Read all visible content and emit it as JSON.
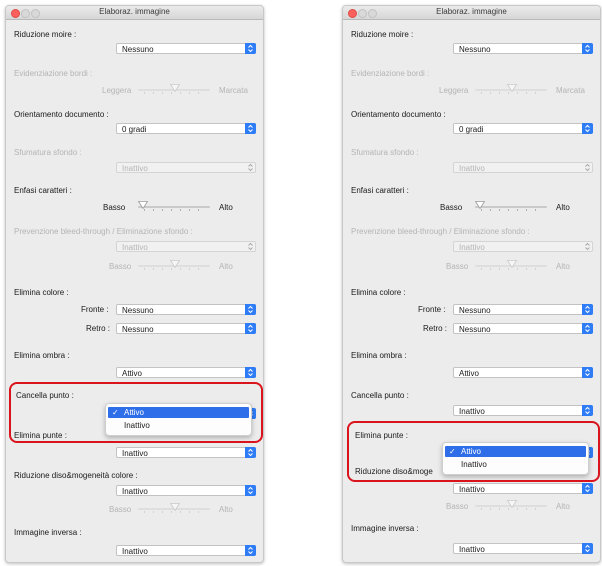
{
  "window_title": "Elaboraz. immagine",
  "moire": {
    "label": "Riduzione moire :",
    "value": "Nessuno"
  },
  "edge": {
    "label": "Evidenziazione bordi :",
    "low": "Leggera",
    "high": "Marcata"
  },
  "orient": {
    "label": "Orientamento documento :",
    "value": "0 gradi"
  },
  "bgshade": {
    "label": "Sfumatura sfondo :",
    "value": "Inattivo"
  },
  "charemph": {
    "label": "Enfasi caratteri :",
    "low": "Basso",
    "high": "Alto"
  },
  "bleed": {
    "label": "Prevenzione bleed-through / Eliminazione sfondo :",
    "value": "Inattivo",
    "low": "Basso",
    "high": "Alto"
  },
  "dropout": {
    "label": "Elimina colore :",
    "front_label": "Fronte :",
    "front_value": "Nessuno",
    "back_label": "Retro :",
    "back_value": "Nessuno"
  },
  "shadow": {
    "label": "Elimina ombra :",
    "value": "Attivo"
  },
  "dots": {
    "label": "Cancella punto :",
    "value": "Inattivo"
  },
  "punch": {
    "label": "Elimina punte :",
    "value": "Inattivo"
  },
  "dither": {
    "label": "Riduzione diso&mogeneità colore :",
    "label_clipped": "Riduzione diso&moge",
    "value": "Inattivo",
    "low": "Basso",
    "high": "Alto"
  },
  "invert": {
    "label": "Immagine inversa :",
    "value": "Inattivo"
  },
  "popup": {
    "options": [
      "Attivo",
      "Inattivo"
    ],
    "selected": "Attivo",
    "check": "✓"
  },
  "colors": {
    "accent": "#2e7cf6",
    "highlight_box": "#d9141c",
    "menu_selection": "#2e6ee8",
    "window_bg": "#ececec"
  }
}
